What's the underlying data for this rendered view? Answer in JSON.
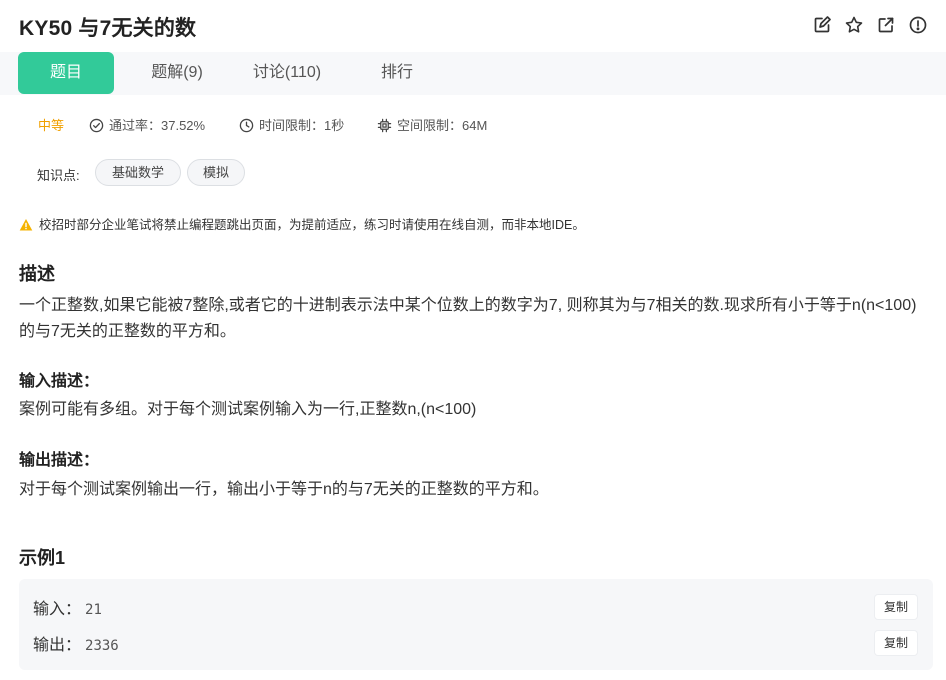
{
  "header": {
    "title": "KY50  与7无关的数",
    "icons": [
      "edit-icon",
      "star-icon",
      "external-link-icon",
      "info-icon"
    ]
  },
  "tabs": [
    {
      "label": "题目",
      "active": true
    },
    {
      "label": "题解(9)",
      "active": false
    },
    {
      "label": "讨论(110)",
      "active": false
    },
    {
      "label": "排行",
      "active": false
    }
  ],
  "meta": {
    "difficulty": "中等",
    "pass_rate": "通过率：37.52%",
    "time_limit": "时间限制：1秒",
    "memory_limit": "空间限制：64M"
  },
  "tags": {
    "label": "知识点:",
    "items": [
      "基础数学",
      "模拟"
    ]
  },
  "notice": "校招时部分企业笔试将禁止编程题跳出页面，为提前适应，练习时请使用在线自测，而非本地IDE。",
  "description": {
    "heading": "描述",
    "text": "一个正整数,如果它能被7整除,或者它的十进制表示法中某个位数上的数字为7, 则称其为与7相关的数.现求所有小于等于n(n<100)的与7无关的正整数的平方和。"
  },
  "input_desc": {
    "heading": "输入描述：",
    "text": "案例可能有多组。对于每个测试案例输入为一行,正整数n,(n<100)"
  },
  "output_desc": {
    "heading": "输出描述：",
    "text": "对于每个测试案例输出一行，输出小于等于n的与7无关的正整数的平方和。"
  },
  "example": {
    "heading": "示例1",
    "input_label": "输入：",
    "input_value": "21",
    "output_label": "输出：",
    "output_value": "2336",
    "copy_label": "复制"
  },
  "colors": {
    "accent": "#32ca99",
    "difficulty": "#f0a000",
    "warning": "#f5b300"
  }
}
